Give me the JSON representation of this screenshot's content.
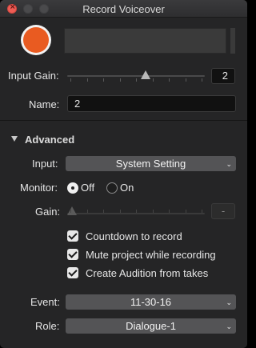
{
  "window": {
    "title": "Record Voiceover"
  },
  "input_gain": {
    "label": "Input Gain:",
    "value": "2",
    "level": 0.57
  },
  "name": {
    "label": "Name:",
    "value": "2"
  },
  "advanced": {
    "label": "Advanced",
    "expanded": true
  },
  "input": {
    "label": "Input:",
    "value": "System Setting"
  },
  "monitor": {
    "label": "Monitor:",
    "options": [
      "Off",
      "On"
    ],
    "selected": "Off"
  },
  "gain": {
    "label": "Gain:",
    "value": "-",
    "level": 0.0,
    "enabled": false
  },
  "options": {
    "countdown": {
      "label": "Countdown to record",
      "checked": true
    },
    "mute": {
      "label": "Mute project while recording",
      "checked": true
    },
    "audition": {
      "label": "Create Audition from takes",
      "checked": true
    }
  },
  "event": {
    "label": "Event:",
    "value": "11-30-16"
  },
  "role": {
    "label": "Role:",
    "value": "Dialogue-1"
  },
  "colors": {
    "record": "#e95b21",
    "close": "#ee5c54",
    "background": "#252526"
  }
}
